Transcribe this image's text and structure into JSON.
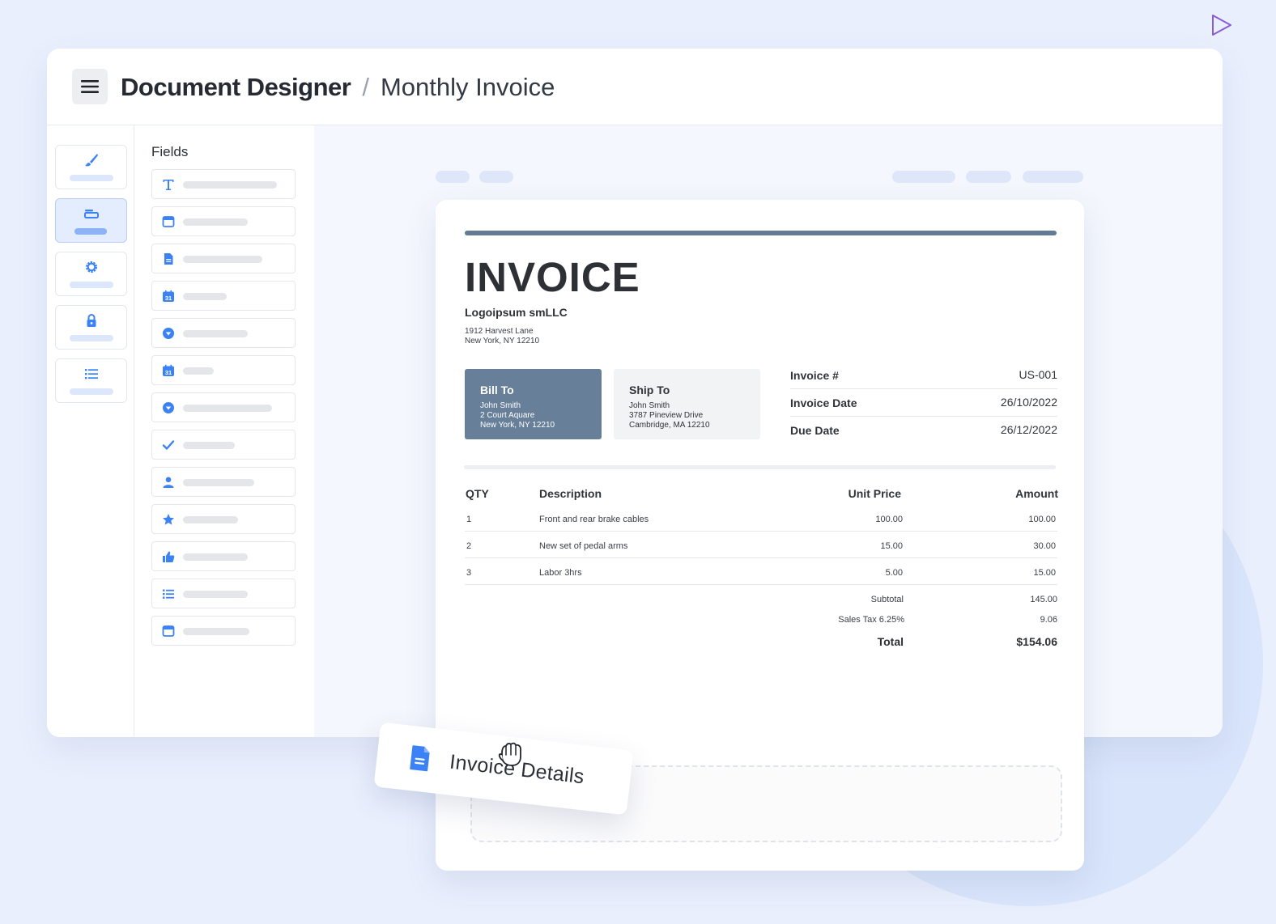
{
  "header": {
    "app_title": "Document Designer",
    "separator": "/",
    "page_title": "Monthly Invoice"
  },
  "rail": {
    "items": [
      {
        "icon": "brush-icon",
        "active": false
      },
      {
        "icon": "fields-icon",
        "active": true
      },
      {
        "icon": "gear-icon",
        "active": false
      },
      {
        "icon": "lock-icon",
        "active": false
      },
      {
        "icon": "list-icon",
        "active": false
      }
    ]
  },
  "fields_panel": {
    "title": "Fields",
    "items": [
      {
        "icon": "text-icon"
      },
      {
        "icon": "window-icon"
      },
      {
        "icon": "document-icon"
      },
      {
        "icon": "calendar-icon"
      },
      {
        "icon": "dropdown-icon"
      },
      {
        "icon": "calendar-icon"
      },
      {
        "icon": "dropdown-icon"
      },
      {
        "icon": "checkmark-icon"
      },
      {
        "icon": "person-icon"
      },
      {
        "icon": "star-icon"
      },
      {
        "icon": "thumbs-up-icon"
      },
      {
        "icon": "list-icon"
      },
      {
        "icon": "window-icon"
      }
    ]
  },
  "invoice": {
    "title": "INVOICE",
    "company": "Logoipsum smLLC",
    "address_line1": "1912 Harvest Lane",
    "address_line2": "New York, NY 12210",
    "bill_to": {
      "title": "Bill To",
      "name": "John Smith",
      "line1": "2 Court Aquare",
      "line2": "New York, NY 12210"
    },
    "ship_to": {
      "title": "Ship To",
      "name": "John Smith",
      "line1": "3787 Pineview Drive",
      "line2": "Cambridge, MA 12210"
    },
    "meta": {
      "number_label": "Invoice #",
      "number": "US-001",
      "date_label": "Invoice Date",
      "date": "26/10/2022",
      "due_label": "Due Date",
      "due": "26/12/2022"
    },
    "table": {
      "headers": {
        "qty": "QTY",
        "description": "Description",
        "unit_price": "Unit Price",
        "amount": "Amount"
      },
      "rows": [
        {
          "qty": "1",
          "description": "Front and rear brake cables",
          "unit_price": "100.00",
          "amount": "100.00"
        },
        {
          "qty": "2",
          "description": "New set of pedal arms",
          "unit_price": "15.00",
          "amount": "30.00"
        },
        {
          "qty": "3",
          "description": "Labor 3hrs",
          "unit_price": "5.00",
          "amount": "15.00"
        }
      ]
    },
    "totals": {
      "subtotal_label": "Subtotal",
      "subtotal": "145.00",
      "tax_label": "Sales Tax 6.25%",
      "tax": "9.06",
      "total_label": "Total",
      "total": "$154.06"
    }
  },
  "drag_card": {
    "icon": "document-icon",
    "label": "Invoice Details"
  },
  "colors": {
    "accent": "#3b82f6",
    "invoice_slate": "#677f99",
    "background": "#e9effd"
  }
}
